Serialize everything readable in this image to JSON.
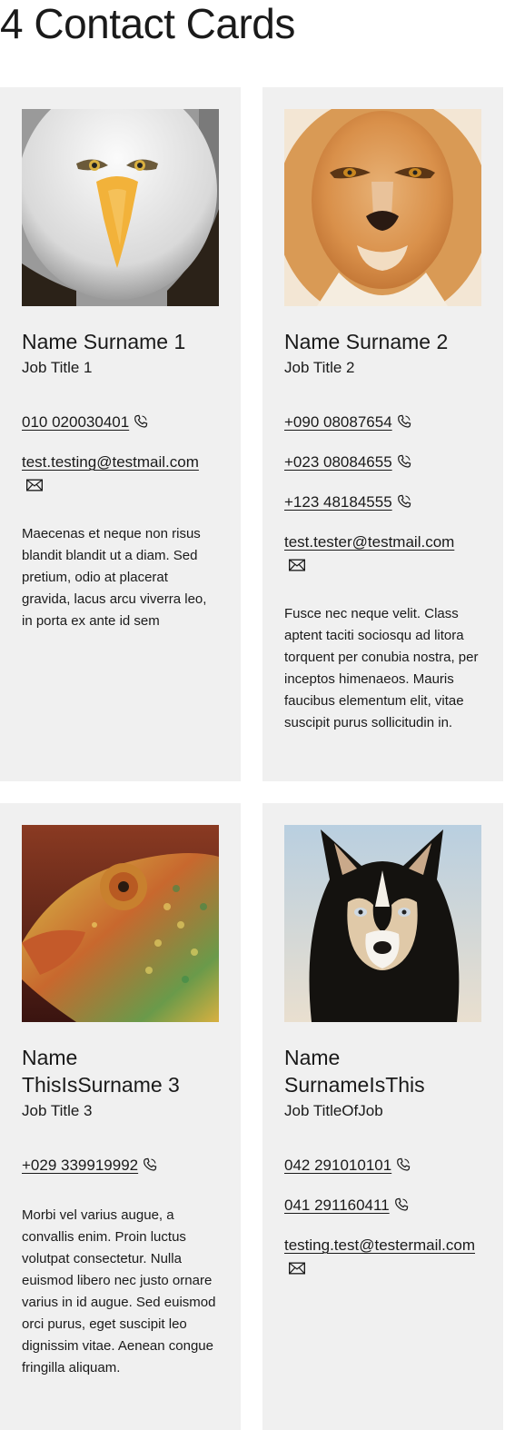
{
  "page": {
    "title": "4 Contact Cards"
  },
  "cards": [
    {
      "name": "Name Surname 1",
      "job": "Job Title 1",
      "phones": [
        "010 020030401"
      ],
      "email": "test.testing@testmail.com",
      "bio": "Maecenas et neque non risus blandit blandit ut a diam. Sed pretium, odio at placerat gravida, lacus arcu viverra leo, in porta ex ante id sem",
      "photo_alt": "eagle"
    },
    {
      "name": "Name Surname 2",
      "job": "Job Title 2",
      "phones": [
        "+090 08087654",
        "+023 08084655",
        "+123 48184555"
      ],
      "email": "test.tester@testmail.com",
      "bio": "Fusce nec neque velit. Class aptent taciti sociosqu ad litora torquent per conubia nostra, per inceptos himenaeos. Mauris faucibus elementum elit, vitae suscipit purus sollicitudin in.",
      "photo_alt": "lion"
    },
    {
      "name": "Name ThisIsSurname 3",
      "job": "Job Title 3",
      "phones": [
        "+029 339919992"
      ],
      "email": "",
      "bio": "Morbi vel varius augue, a convallis enim. Proin luctus volutpat consectetur. Nulla euismod libero nec justo ornare varius in id augue. Sed euismod orci purus, eget suscipit leo dignissim vitae. Aenean congue fringilla aliquam.",
      "photo_alt": "chameleon"
    },
    {
      "name": "Name SurnameIsThis",
      "job": "Job TitleOfJob",
      "phones": [
        "042 291010101",
        "041 291160411"
      ],
      "email": "testing.test@testermail.com",
      "bio": "",
      "photo_alt": "husky"
    }
  ]
}
